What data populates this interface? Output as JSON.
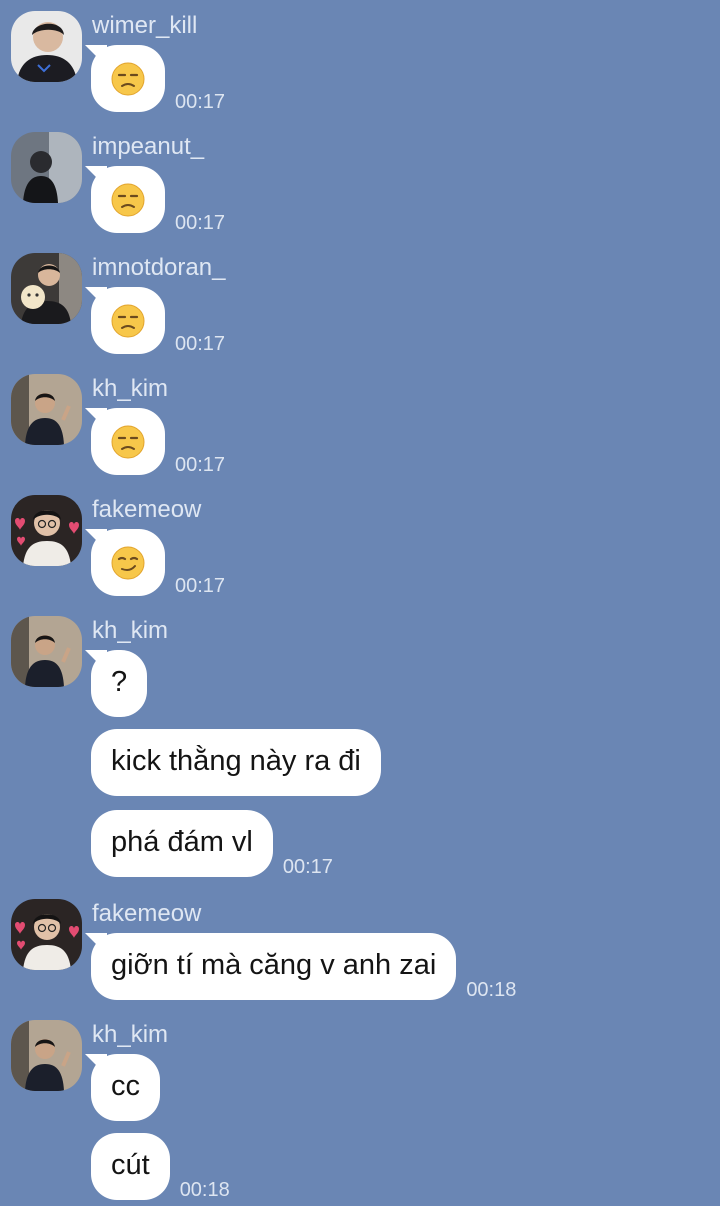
{
  "messages": [
    {
      "user": "wimer_kill",
      "avatar": "avatar-dark",
      "items": [
        {
          "emoji": "face-unamused",
          "time": "00:17"
        }
      ]
    },
    {
      "user": "impeanut_",
      "avatar": "avatar-window",
      "items": [
        {
          "emoji": "face-unamused",
          "time": "00:17"
        }
      ]
    },
    {
      "user": "imnotdoran_",
      "avatar": "avatar-plush",
      "items": [
        {
          "emoji": "face-unamused",
          "time": "00:17"
        }
      ]
    },
    {
      "user": "kh_kim",
      "avatar": "avatar-room",
      "items": [
        {
          "emoji": "face-unamused",
          "time": "00:17"
        }
      ]
    },
    {
      "user": "fakemeow",
      "avatar": "avatar-hearts",
      "items": [
        {
          "emoji": "face-smirk",
          "time": "00:17"
        }
      ]
    },
    {
      "user": "kh_kim",
      "avatar": "avatar-room",
      "items": [
        {
          "text": "?"
        },
        {
          "text": "kick thằng này ra đi"
        },
        {
          "text": "phá đám vl",
          "time": "00:17"
        }
      ]
    },
    {
      "user": "fakemeow",
      "avatar": "avatar-hearts",
      "items": [
        {
          "text": "giỡn tí mà căng v anh zai",
          "time": "00:18"
        }
      ]
    },
    {
      "user": "kh_kim",
      "avatar": "avatar-room",
      "items": [
        {
          "text": "cc"
        },
        {
          "text": "cút",
          "time": "00:18"
        }
      ]
    }
  ],
  "colors": {
    "background": "#6a86b4",
    "bubble": "#ffffff",
    "meta_text": "#dde5f1"
  }
}
